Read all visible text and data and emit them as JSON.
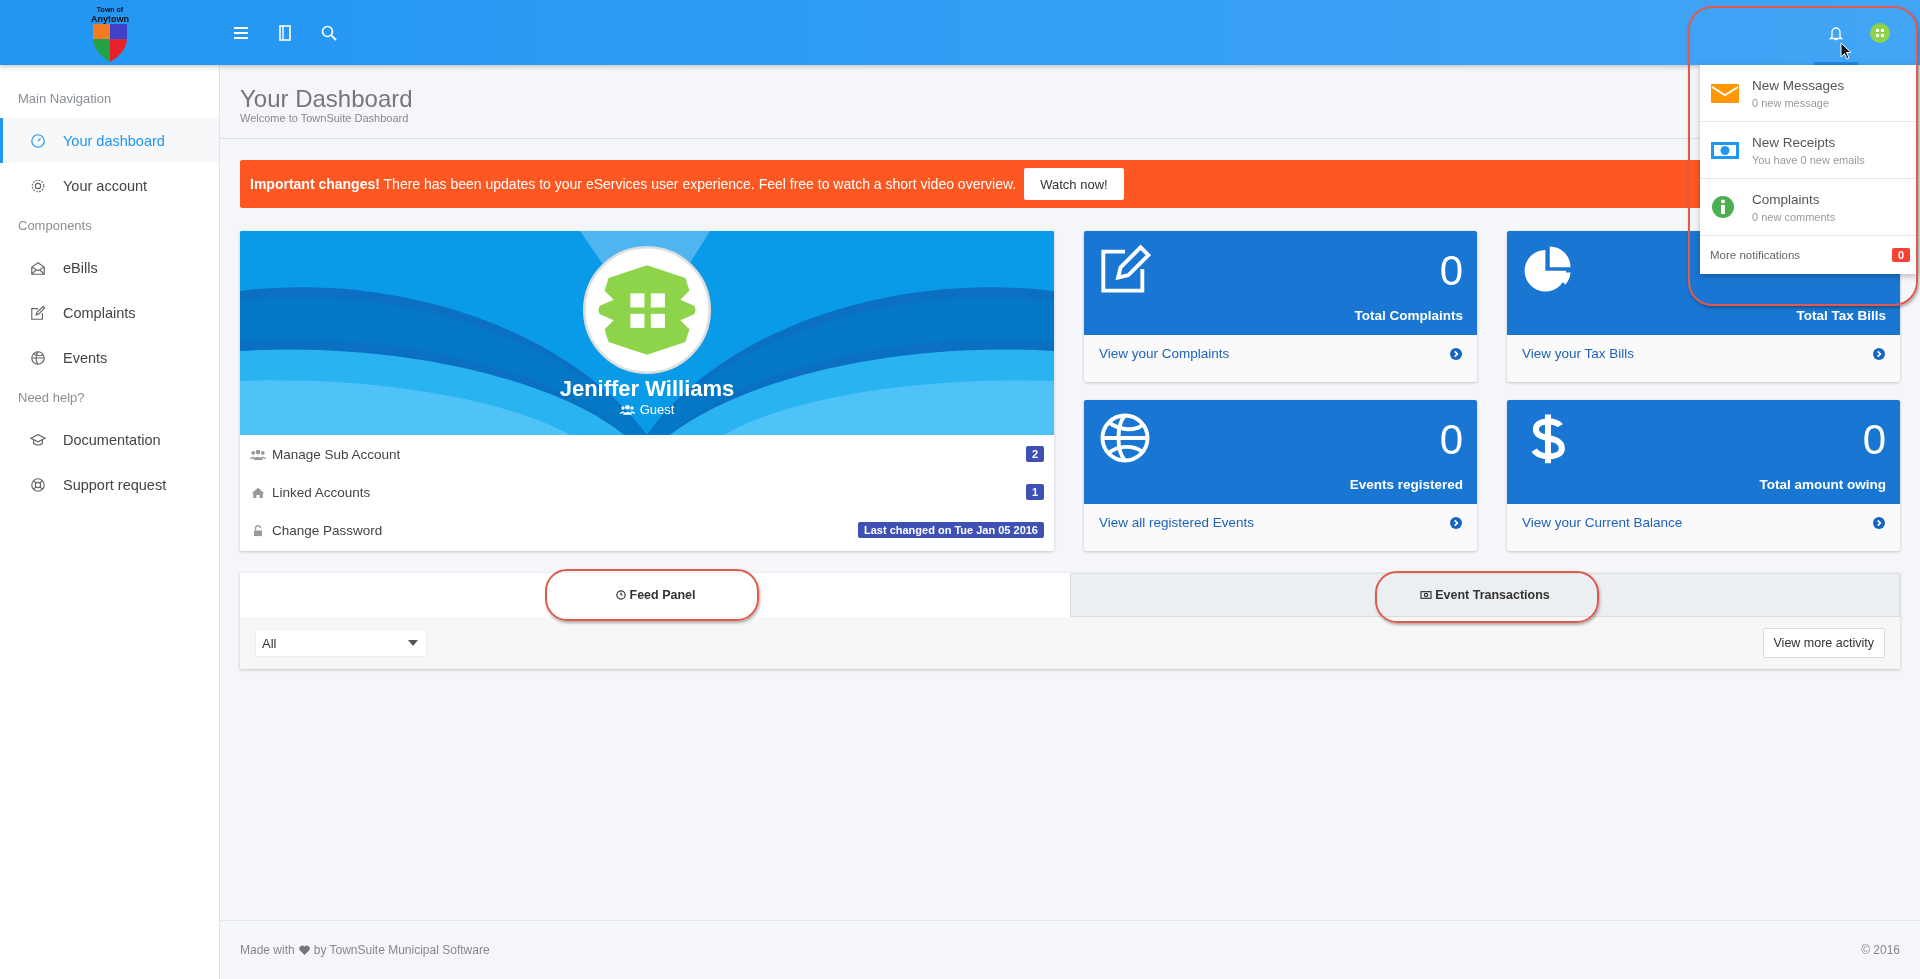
{
  "logo": {
    "small": "Town of",
    "name": "Anytown"
  },
  "sidebar": {
    "sections": [
      {
        "heading": "Main Navigation",
        "items": [
          {
            "label": "Your dashboard",
            "kind": "gauge",
            "selected": true
          },
          {
            "label": "Your account",
            "kind": "gear",
            "selected": false
          }
        ]
      },
      {
        "heading": "Components",
        "items": [
          {
            "label": "eBills",
            "kind": "envelope",
            "selected": false
          },
          {
            "label": "Complaints",
            "kind": "edit",
            "selected": false
          },
          {
            "label": "Events",
            "kind": "ball",
            "selected": false
          }
        ]
      },
      {
        "heading": "Need help?",
        "items": [
          {
            "label": "Documentation",
            "kind": "cap",
            "selected": false
          },
          {
            "label": "Support request",
            "kind": "lifebuoy",
            "selected": false
          }
        ]
      }
    ]
  },
  "page": {
    "title": "Your Dashboard",
    "subtitle": "Welcome to TownSuite Dashboard"
  },
  "alert": {
    "text": "**Important changes!** There has been updates to your eServices user experience. Feel free to watch a short video overview.",
    "button": "Watch now!"
  },
  "profile": {
    "name": "Jeniffer Williams",
    "role": "Guest",
    "rows": [
      {
        "kind": "users",
        "label": "Manage Sub Account",
        "badge": "2"
      },
      {
        "kind": "home",
        "label": "Linked Accounts",
        "badge": "1"
      },
      {
        "kind": "lock",
        "label": "Change Password",
        "badge": "Last changed on Tue Jan 05 2016"
      }
    ]
  },
  "stats": [
    {
      "kind": "edit",
      "value": "0",
      "label": "Total Complaints",
      "link": "View your Complaints"
    },
    {
      "kind": "pie",
      "label": "Total Tax Bills",
      "link": "View your Tax Bills"
    },
    {
      "kind": "ball",
      "value": "0",
      "label": "Events registered",
      "link": "View all registered Events"
    },
    {
      "kind": "dollar",
      "value": "0",
      "label": "Total amount owing",
      "link": "View your Current Balance"
    }
  ],
  "notifications": {
    "items": [
      {
        "kind": "mail",
        "title": "New Messages",
        "subtitle": "0 new message"
      },
      {
        "kind": "money",
        "title": "New Receipts",
        "subtitle": "You have 0 new emails"
      },
      {
        "kind": "info",
        "title": "Complaints",
        "subtitle": "0 new comments"
      }
    ],
    "more": "More notifications",
    "count": "0"
  },
  "feed": {
    "tabs": [
      {
        "label": "Feed Panel",
        "kind": "clock",
        "selected": true
      },
      {
        "label": "Event Transactions",
        "kind": "money",
        "selected": false
      }
    ],
    "filter": "All",
    "button": "View more activity"
  },
  "footer": {
    "before": "Made with",
    "after": "by TownSuite Municipal Software",
    "copyright": "© 2016"
  }
}
